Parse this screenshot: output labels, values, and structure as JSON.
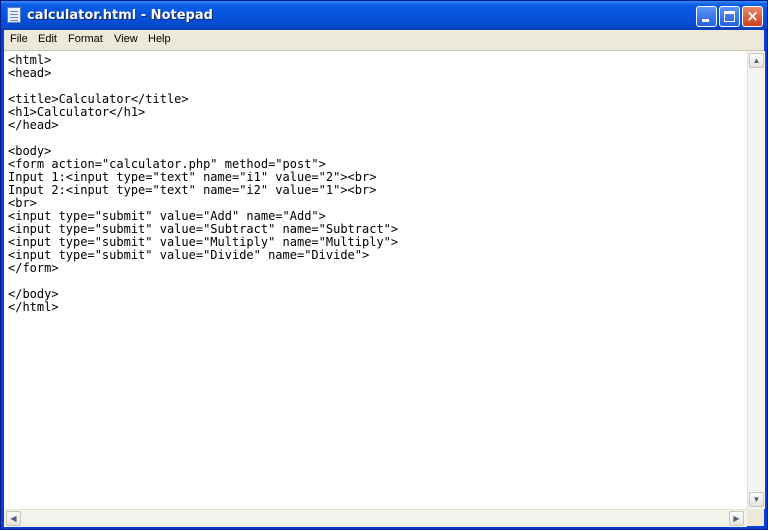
{
  "window": {
    "title": "calculator.html - Notepad",
    "buttons": {
      "minimize": "minimize",
      "maximize": "maximize",
      "close": "×"
    }
  },
  "menubar": {
    "items": [
      "File",
      "Edit",
      "Format",
      "View",
      "Help"
    ]
  },
  "editor": {
    "text": "<html>\n<head>\n\n<title>Calculator</title>\n<h1>Calculator</h1>\n</head>\n\n<body>\n<form action=\"calculator.php\" method=\"post\">\nInput 1:<input type=\"text\" name=\"i1\" value=\"2\"><br>\nInput 2:<input type=\"text\" name=\"i2\" value=\"1\"><br>\n<br>\n<input type=\"submit\" value=\"Add\" name=\"Add\">\n<input type=\"submit\" value=\"Subtract\" name=\"Subtract\">\n<input type=\"submit\" value=\"Multiply\" name=\"Multiply\">\n<input type=\"submit\" value=\"Divide\" name=\"Divide\">\n</form>\n\n</body>\n</html>"
  },
  "scrollbars": {
    "up_arrow": "▲",
    "down_arrow": "▼",
    "left_arrow": "◀",
    "right_arrow": "▶"
  },
  "icons": {
    "app": "notepad-icon"
  },
  "colors": {
    "titlebar": "#0753dc",
    "menubar": "#ece9d8",
    "close_button": "#c8401c"
  }
}
